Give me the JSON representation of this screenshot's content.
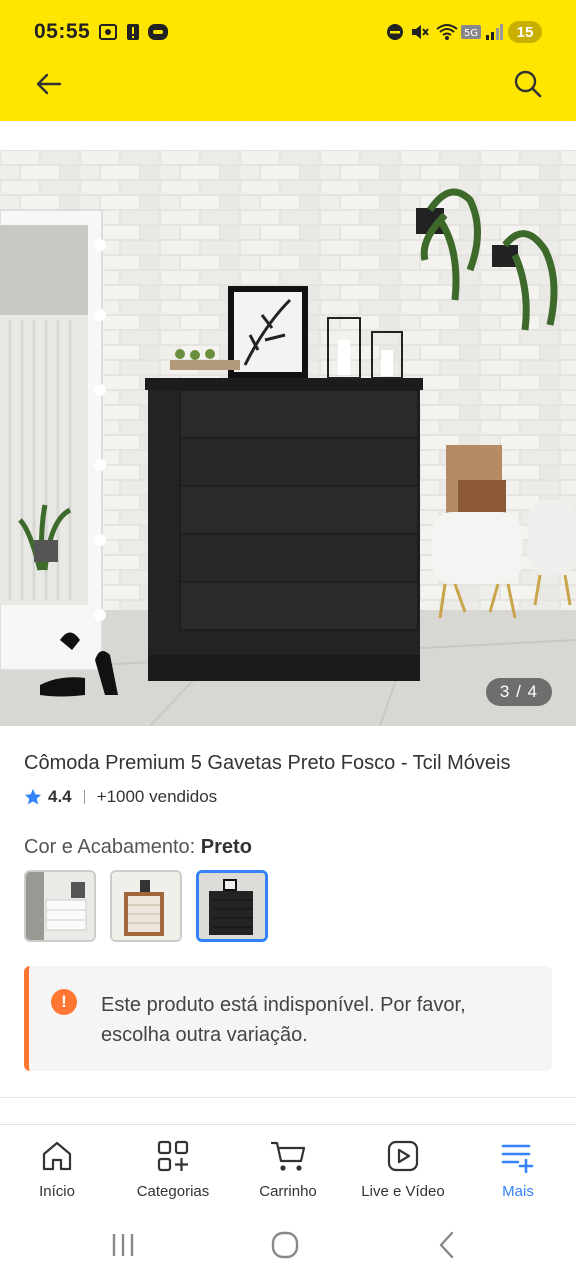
{
  "status_bar": {
    "time": "05:55",
    "battery": "15",
    "icons": [
      "screenshot-icon",
      "alert-icon",
      "app-badge-icon",
      "do-not-disturb-icon",
      "mute-icon",
      "wifi-icon",
      "5g-icon",
      "signal-icon",
      "battery-icon"
    ]
  },
  "header": {
    "icons": [
      "back-arrow-icon",
      "search-icon"
    ],
    "bg_color": "#ffe600"
  },
  "gallery": {
    "counter": "3 / 4"
  },
  "product": {
    "title": "Cômoda Premium 5 Gavetas Preto Fosco - Tcil Móveis",
    "rating": "4.4",
    "sold": "+1000 vendidos"
  },
  "variant": {
    "label": "Cor e Acabamento: ",
    "selected": "Preto",
    "options": [
      "Branco",
      "Marrom",
      "Preto"
    ],
    "accent": "#3483fa"
  },
  "notice": {
    "text": "Este produto está indisponível. Por favor, escolha outra variação.",
    "icon": "!",
    "color": "#ff7733"
  },
  "bottom_nav": {
    "items": [
      {
        "label": "Início",
        "icon": "home-icon"
      },
      {
        "label": "Categorias",
        "icon": "categories-icon"
      },
      {
        "label": "Carrinho",
        "icon": "cart-icon"
      },
      {
        "label": "Live e Vídeo",
        "icon": "play-icon"
      },
      {
        "label": "Mais",
        "icon": "menu-plus-icon",
        "active": true
      }
    ]
  },
  "system_nav": {
    "icons": [
      "recents-icon",
      "home-circle-icon",
      "back-chevron-icon"
    ]
  }
}
